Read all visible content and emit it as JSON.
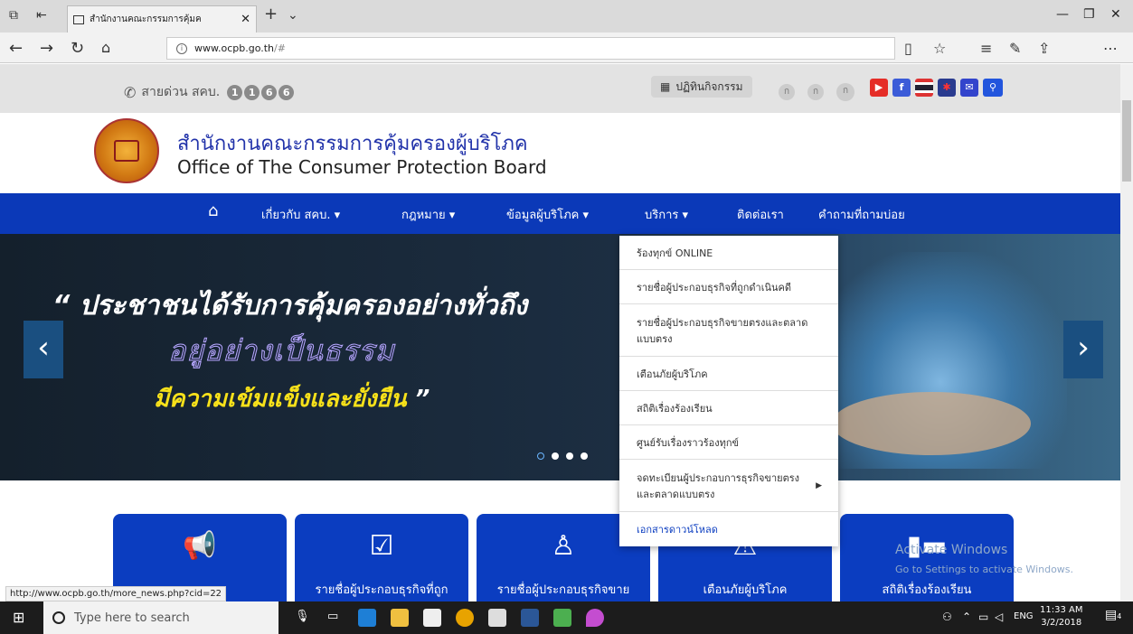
{
  "browser": {
    "tab_title": "สำนักงานคณะกรรมการคุ้มค",
    "url_host": "www.ocpb.go.th",
    "url_hash": "/#"
  },
  "site": {
    "hotline_label": "สายด่วน สคบ.",
    "hotline_digits": [
      "1",
      "1",
      "6",
      "6"
    ],
    "activities_label": "ปฏิทินกิจกรรม",
    "font_sizes": [
      "ก",
      "ก",
      "ก"
    ],
    "title_th": "สำนักงานคณะกรรมการคุ้มครองผู้บริโภค",
    "title_en": "Office of The Consumer Protection Board"
  },
  "nav": {
    "items": [
      "เกี่ยวกับ สคบ.",
      "กฎหมาย",
      "ข้อมูลผู้บริโภค",
      "บริการ",
      "ติดต่อเรา",
      "คำถามที่ถามบ่อย"
    ],
    "arrow": "▾"
  },
  "banner": {
    "line1": "“ ประชาชนได้รับการคุ้มครองอย่างทั่วถึง",
    "line2": "อยู่อย่างเป็นธรรม",
    "line3": "มีความเข้มแข็งและยั่งยืน",
    "line3_quote": "”"
  },
  "dropdown": {
    "items": [
      "ร้องทุกข์ ONLINE",
      "รายชื่อผู้ประกอบธุรกิจที่ถูกดำเนินคดี",
      "รายชื่อผู้ประกอบธุรกิจขายตรงและตลาดแบบตรง",
      "เตือนภัยผู้บริโภค",
      "สถิติเรื่องร้องเรียน",
      "ศูนย์รับเรื่องราวร้องทุกข์",
      "จดทะเบียนผู้ประกอบการธุรกิจขายตรงและตลาดแบบตรง",
      "เอกสารดาวน์โหลด"
    ]
  },
  "cards": [
    {
      "label": "",
      "icon": "megaphone-icon"
    },
    {
      "label": "รายชื่อผู้ประกอบธุรกิจที่ถูก",
      "icon": "checklist-icon"
    },
    {
      "label": "รายชื่อผู้ประกอบธุรกิจขาย",
      "icon": "hierarchy-icon"
    },
    {
      "label": "เตือนภัยผู้บริโภค",
      "icon": "warning-icon"
    },
    {
      "label": "สถิติเรื่องร้องเรียน",
      "icon": "chart-icon"
    }
  ],
  "status_url": "http://www.ocpb.go.th/more_news.php?cid=22",
  "watermark": {
    "line1": "Activate Windows",
    "line2": "Go to Settings to activate Windows."
  },
  "taskbar": {
    "search_placeholder": "Type here to search",
    "lang": "ENG",
    "time": "11:33 AM",
    "date": "3/2/2018",
    "notification_count": "4"
  }
}
